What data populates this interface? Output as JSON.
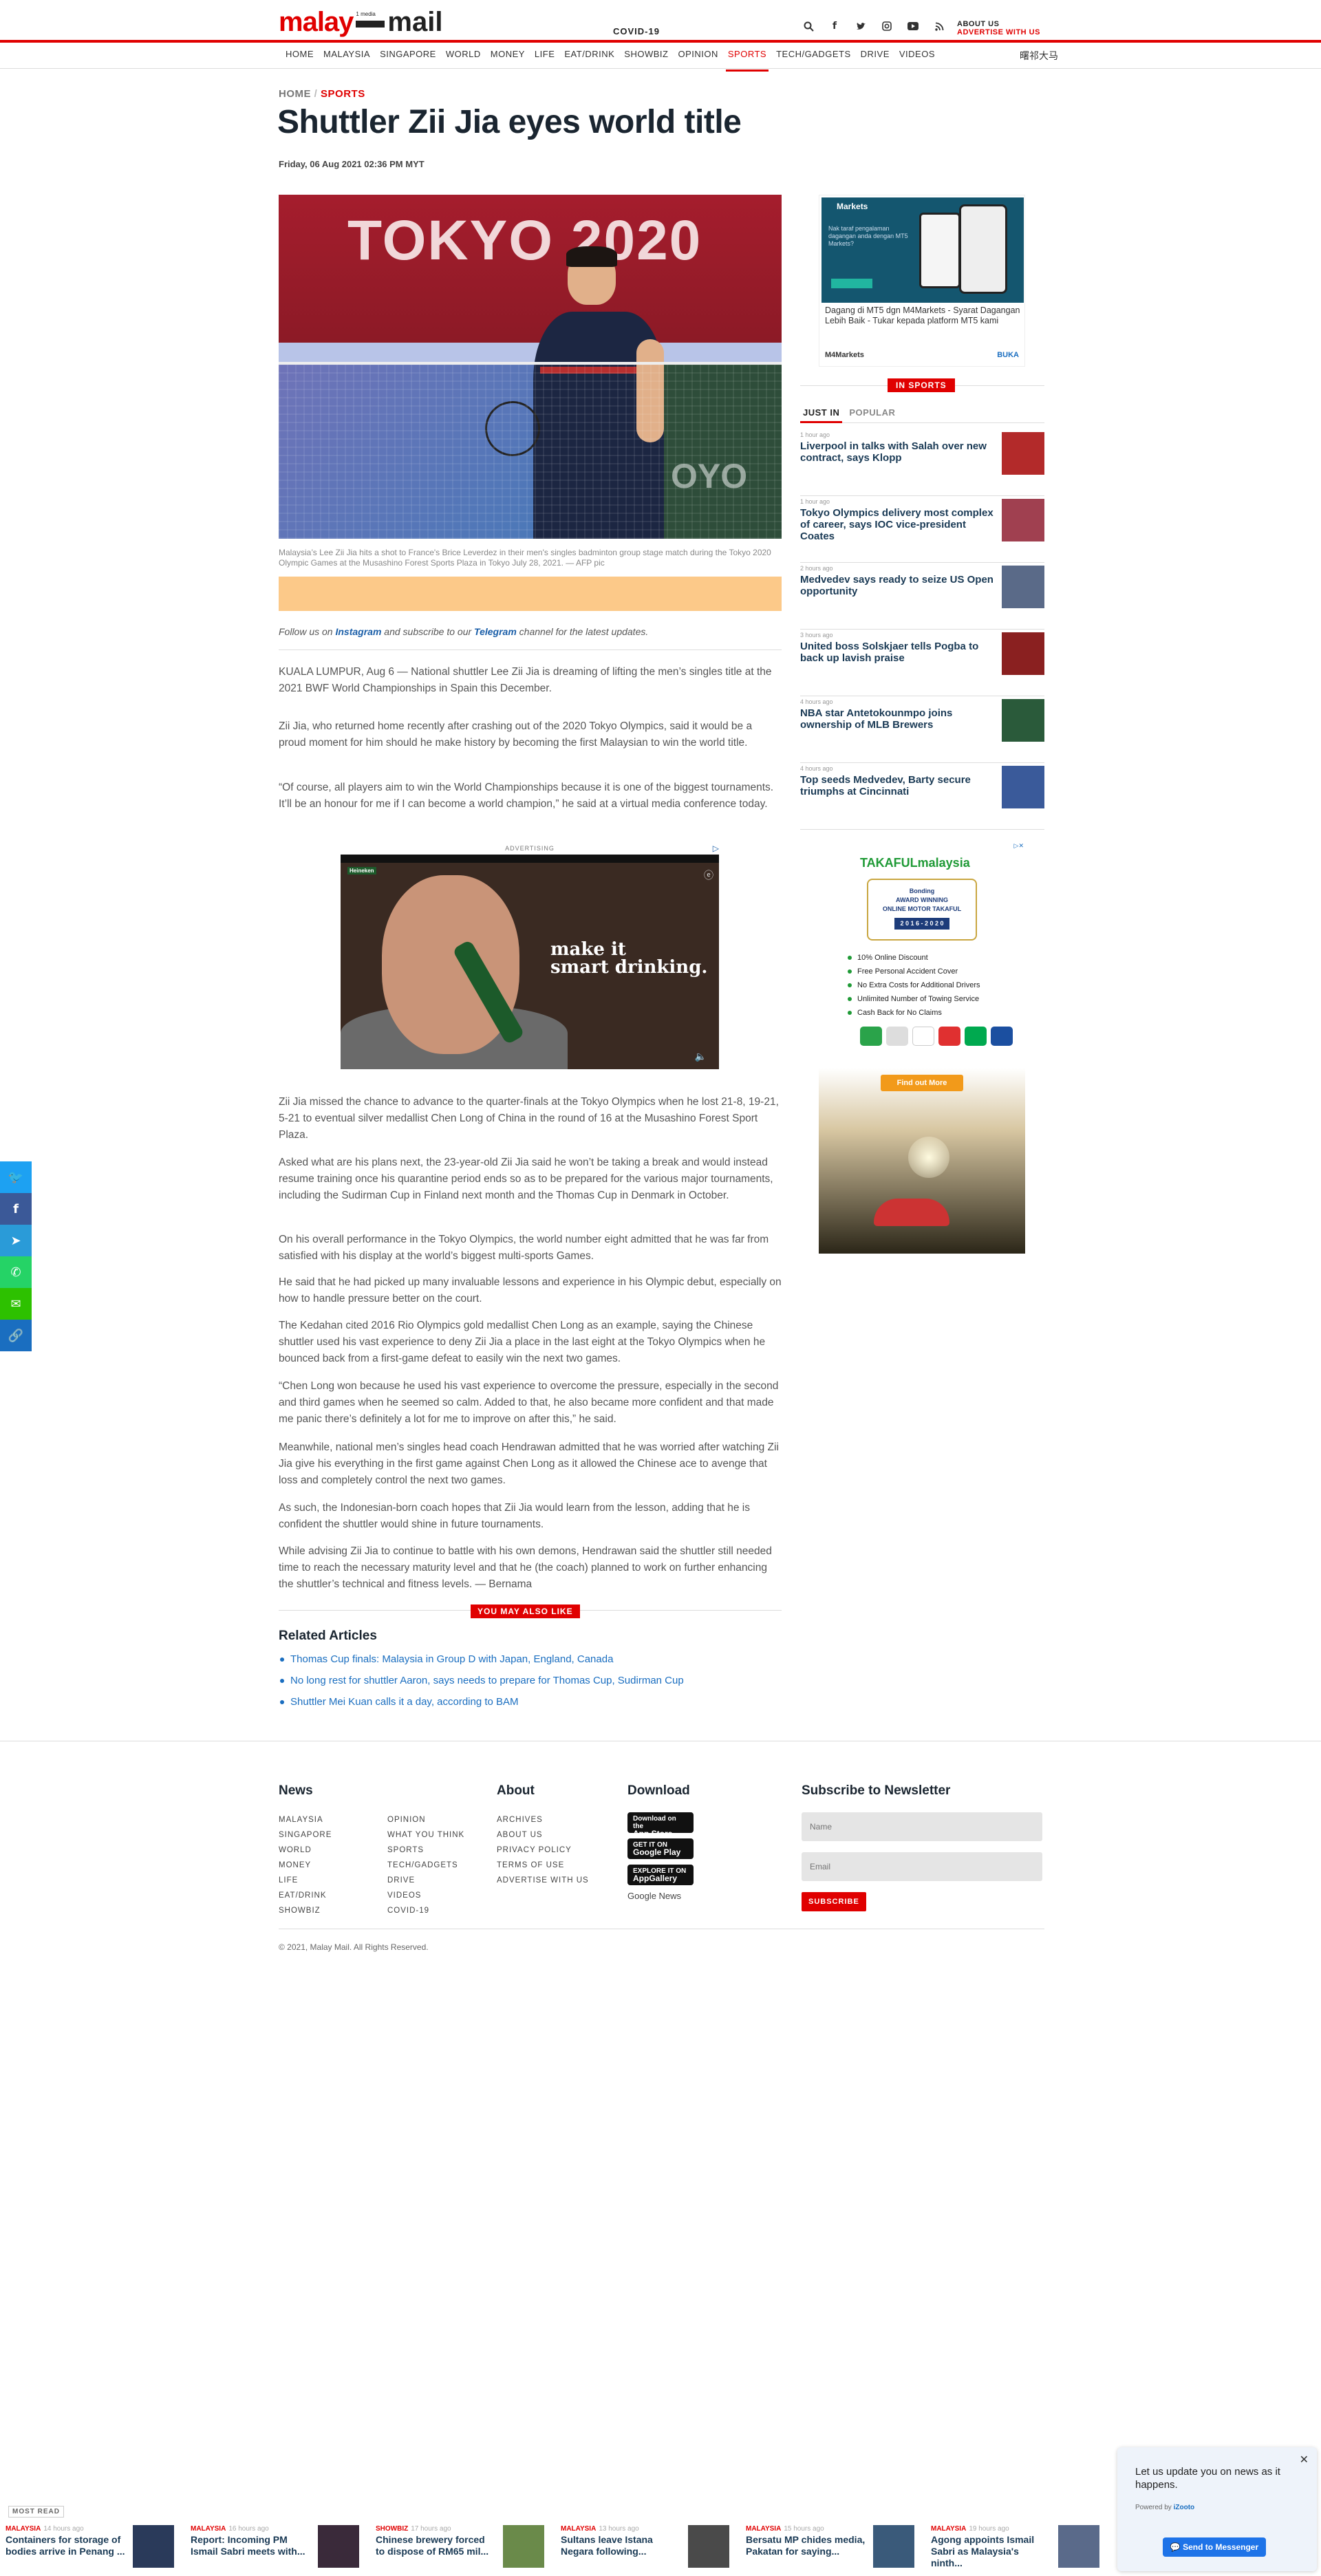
{
  "header": {
    "logo_left": "malay",
    "logo_small": "1 media",
    "logo_right": "mail",
    "covid": "COVID-19",
    "icons": [
      "search-icon",
      "facebook-icon",
      "twitter-icon",
      "instagram-icon",
      "youtube-icon",
      "rss-icon"
    ],
    "about": "ABOUT US",
    "advertise": "ADVERTISE WITH US"
  },
  "nav": {
    "items": [
      "HOME",
      "MALAYSIA",
      "SINGAPORE",
      "WORLD",
      "MONEY",
      "LIFE",
      "EAT/DRINK",
      "SHOWBIZ",
      "OPINION",
      "SPORTS",
      "TECH/GADGETS",
      "DRIVE",
      "VIDEOS"
    ],
    "active": "SPORTS",
    "chinese": "曙祁大马"
  },
  "article": {
    "breadcrumb_home": "HOME",
    "breadcrumb_sep": "/",
    "breadcrumb_section": "SPORTS",
    "title": "Shuttler Zii Jia eyes world title",
    "date": "Friday, 06 Aug 2021 02:36 PM MYT",
    "image_text": "TOKYO 2020",
    "caption": "Malaysia’s Lee Zii Jia hits a shot to France's Brice Leverdez in their men's singles badminton group stage match during the Tokyo 2020 Olympic Games at the Musashino Forest Sports Plaza in Tokyo July 28, 2021. — AFP pic",
    "follow_pre": "Follow us on ",
    "follow_instagram": "Instagram",
    "follow_mid": " and subscribe to our ",
    "follow_telegram": "Telegram",
    "follow_post": " channel for the latest updates.",
    "paragraphs": [
      "KUALA LUMPUR, Aug 6 — National shuttler Lee Zii Jia is dreaming of lifting the men’s singles title at the 2021 BWF World Championships in Spain this December.",
      "Zii Jia, who returned home recently after crashing out of the 2020 Tokyo Olympics, said it would be a proud moment for him should he make history by becoming the first Malaysian to win the world title.",
      "“Of course, all players aim to win the World Championships because it is one of the biggest tournaments. It’ll be an honour for me if I can become a world champion,” he said at a virtual media conference today.",
      "Zii Jia missed the chance to advance to the quarter-finals at the Tokyo Olympics when he lost 21-8, 19-21, 5-21 to eventual silver medallist Chen Long of China in the round of 16 at the Musashino Forest Sport Plaza.",
      "Asked what are his plans next, the 23-year-old Zii Jia said he won’t be taking a break and would instead resume training once his quarantine period ends so as to be prepared for the various major tournaments, including the Sudirman Cup in Finland next month and the Thomas Cup in Denmark in October.",
      "On his overall performance in the Tokyo Olympics, the world number eight admitted that he was far from satisfied with his display at the world’s biggest multi-sports Games.",
      "He said that he had picked up many invaluable lessons and experience in his Olympic debut, especially on how to handle pressure better on the court.",
      "The Kedahan cited 2016 Rio Olympics gold medallist Chen Long as an example, saying the Chinese shuttler used his vast experience to deny Zii Jia a place in the last eight at the Tokyo Olympics when he bounced back from a first-game defeat to easily win the next two games.",
      "“Chen Long won because he used his vast experience to overcome the pressure, especially in the second and third games when he seemed so calm. Added to that, he also became more confident and that made me panic there’s definitely a lot for me to improve on after this,” he said.",
      "Meanwhile, national men’s singles head coach Hendrawan admitted that he was worried after watching Zii Jia give his everything in the first game against Chen Long as it allowed the Chinese ace to avenge that loss and completely control the next two games.",
      "As such, the Indonesian-born coach hopes that Zii Jia would learn from the lesson, adding that he is confident the shuttler would shine in future tournaments.",
      "While advising Zii Jia to continue to battle with his own demons, Hendrawan said the shuttler still needed time to reach the necessary maturity level and that he (the coach) planned to work on further enhancing the shuttler’s technical and fitness levels. — Bernama"
    ]
  },
  "video_ad": {
    "label": "ADVERTISING",
    "text1": "make it",
    "text2": "smart drinking.",
    "sponsor": "Heineken"
  },
  "may_also_like": "YOU MAY ALSO LIKE",
  "related": {
    "heading": "Related Articles",
    "items": [
      "Thomas Cup finals: Malaysia in Group D with Japan, England, Canada",
      "No long rest for shuttler Aaron, says needs to prepare for Thomas Cup, Sudirman Cup",
      "Shuttler Mei Kuan calls it a day, according to BAM"
    ]
  },
  "side_ad": {
    "brand_top": "Markets",
    "screen_text": "Nak taraf pengalaman dagangan anda dengan MT5 Markets?",
    "text": "Dagang di MT5 dgn M4Markets - Syarat Dagangan Lebih Baik - Tukar kepada platform MT5 kami",
    "brand": "M4Markets",
    "cta": "BUKA"
  },
  "sidebar": {
    "in_sports": "IN SPORTS",
    "tab_just_in": "JUST IN",
    "tab_popular": "POPULAR",
    "news": [
      {
        "time": "1 hour ago",
        "headline": "Liverpool in talks with Salah over new contract, says Klopp",
        "color": "#b32a2a"
      },
      {
        "time": "1 hour ago",
        "headline": "Tokyo Olympics delivery most complex of career, says IOC vice-president Coates",
        "color": "#a04050"
      },
      {
        "time": "2 hours ago",
        "headline": "Medvedev says ready to seize US Open opportunity",
        "color": "#5a6a88"
      },
      {
        "time": "3 hours ago",
        "headline": "United boss Solskjaer tells Pogba to back up lavish praise",
        "color": "#8a2020"
      },
      {
        "time": "4 hours ago",
        "headline": "NBA star Antetokounmpo joins ownership of MLB Brewers",
        "color": "#2a5a3a"
      },
      {
        "time": "4 hours ago",
        "headline": "Top seeds Medvedev, Barty secure triumphs at Cincinnati",
        "color": "#3a5a9a"
      }
    ]
  },
  "takaful_ad": {
    "brand": "TAKAFULmalaysia",
    "badge_top": "Bonding",
    "badge1": "AWARD WINNING",
    "badge2": "ONLINE MOTOR TAKAFUL",
    "years": "2 0 1 6  -  2 0 2 0",
    "perks": [
      "10% Online Discount",
      "Free Personal Accident Cover",
      "No Extra Costs for Additional Drivers",
      "Unlimited Number of Towing Service",
      "Cash Back for No Claims"
    ],
    "cta": "Find out More"
  },
  "share": {
    "icons": [
      {
        "name": "twitter-share-icon",
        "glyph": "🐦",
        "color": "#1da1f2"
      },
      {
        "name": "facebook-share-icon",
        "glyph": "f",
        "color": "#3b5998"
      },
      {
        "name": "telegram-share-icon",
        "glyph": "➤",
        "color": "#2a9bd8"
      },
      {
        "name": "whatsapp-share-icon",
        "glyph": "✆",
        "color": "#25d366"
      },
      {
        "name": "wechat-share-icon",
        "glyph": "✉",
        "color": "#2dc100"
      },
      {
        "name": "copy-link-share-icon",
        "glyph": "🔗",
        "color": "#1a6ec0"
      }
    ]
  },
  "footer": {
    "news_heading": "News",
    "news_col1": [
      "MALAYSIA",
      "SINGAPORE",
      "WORLD",
      "MONEY",
      "LIFE",
      "EAT/DRINK",
      "SHOWBIZ"
    ],
    "news_col2": [
      "OPINION",
      "WHAT YOU THINK",
      "SPORTS",
      "TECH/GADGETS",
      "DRIVE",
      "VIDEOS",
      "COVID-19"
    ],
    "about_heading": "About",
    "about_links": [
      "ARCHIVES",
      "ABOUT US",
      "PRIVACY POLICY",
      "TERMS OF USE",
      "ADVERTISE WITH US"
    ],
    "download_heading": "Download",
    "stores": [
      {
        "small": "Download on the",
        "big": "App Store"
      },
      {
        "small": "GET IT ON",
        "big": "Google Play"
      },
      {
        "small": "EXPLORE IT ON",
        "big": "AppGallery"
      }
    ],
    "google_news": "Google News",
    "newsletter_heading": "Subscribe to Newsletter",
    "name_placeholder": "Name",
    "email_placeholder": "Email",
    "subscribe": "SUBSCRIBE",
    "copyright": "© 2021, Malay Mail. All Rights Reserved."
  },
  "most_read": {
    "label": "MOST READ",
    "items": [
      {
        "cat": "MALAYSIA",
        "time": "14 hours ago",
        "headline": "Containers for storage of bodies arrive in Penang ...",
        "color": "#2a3a5a"
      },
      {
        "cat": "MALAYSIA",
        "time": "16 hours ago",
        "headline": "Report: Incoming PM Ismail Sabri meets with...",
        "color": "#3a2a3a"
      },
      {
        "cat": "SHOWBIZ",
        "time": "17 hours ago",
        "headline": "Chinese brewery forced to dispose of RM65 mil...",
        "color": "#6a8a4a"
      },
      {
        "cat": "MALAYSIA",
        "time": "13 hours ago",
        "headline": "Sultans leave Istana Negara following...",
        "color": "#4a4a4a"
      },
      {
        "cat": "MALAYSIA",
        "time": "15 hours ago",
        "headline": "Bersatu MP chides media, Pakatan for saying...",
        "color": "#3a5a7a"
      },
      {
        "cat": "MALAYSIA",
        "time": "19 hours ago",
        "headline": "Agong appoints Ismail Sabri as Malaysia's ninth...",
        "color": "#5a6a8a"
      }
    ]
  },
  "izooto": {
    "message": "Let us update you on news as it happens.",
    "powered": "Powered by ",
    "powered_brand": "iZooto",
    "button": "Send to Messenger"
  }
}
